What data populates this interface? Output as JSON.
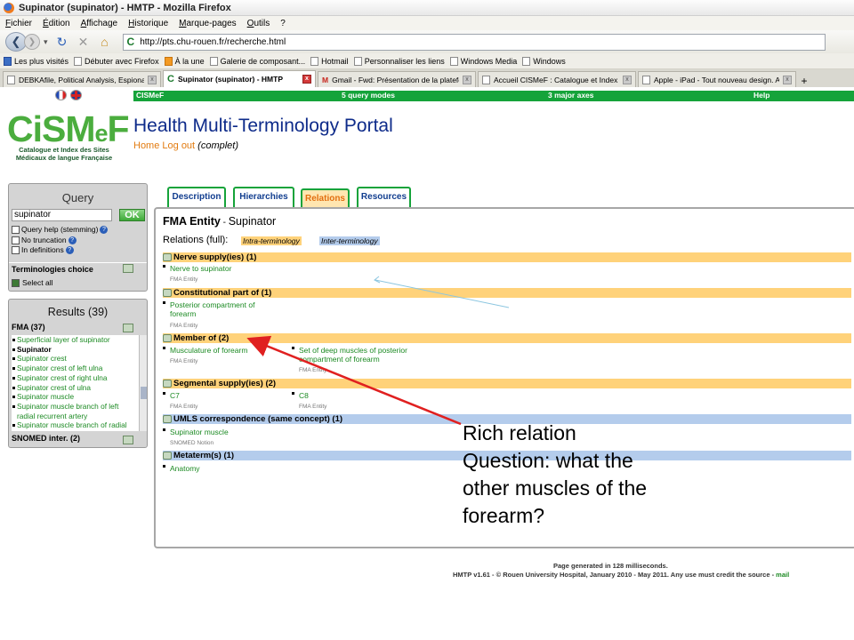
{
  "browser": {
    "window_title": "Supinator (supinator) - HMTP - Mozilla Firefox",
    "menu": [
      "Fichier",
      "Édition",
      "Affichage",
      "Historique",
      "Marque-pages",
      "Outils",
      "?"
    ],
    "url": "http://pts.chu-rouen.fr/recherche.html",
    "bookmarks": [
      "Les plus visités",
      "Débuter avec Firefox",
      "À la une",
      "Galerie de composant...",
      "Hotmail",
      "Personnaliser les liens",
      "Windows Media",
      "Windows"
    ],
    "tabs": [
      {
        "label": "DEBKAfile, Political Analysis, Espionage..."
      },
      {
        "label": "Supinator (supinator) - HMTP",
        "active": true
      },
      {
        "label": "Gmail - Fwd: Présentation de la platefo..."
      },
      {
        "label": "Accueil CISMeF : Catalogue et Index d..."
      },
      {
        "label": "Apple - iPad - Tout nouveau design. Ap..."
      }
    ]
  },
  "site": {
    "nav": [
      "CISMeF",
      "5 query modes",
      "3 major axes",
      "Help"
    ],
    "logo": {
      "text_a": "CiSM",
      "text_e": "e",
      "text_f": "F",
      "subtitle": "Catalogue et Index des Sites Médicaux de langue Française"
    },
    "title": "Health Multi-Terminology Portal",
    "home": "Home",
    "logout": "Log out",
    "logout_suffix": "(complet)"
  },
  "query": {
    "header": "Query",
    "value": "supinator",
    "ok": "OK",
    "options": [
      "Query help (stemming)",
      "No truncation",
      "In definitions"
    ],
    "terminologies_choice": "Terminologies choice",
    "select_all": "Select all"
  },
  "results": {
    "header": "Results (39)",
    "fma": "FMA (37)",
    "items": [
      "Superficial layer of supinator",
      "Supinator",
      "Supinator crest",
      "Supinator crest of left ulna",
      "Supinator crest of right ulna",
      "Supinator crest of ulna",
      "Supinator muscle",
      "Supinator muscle branch of left",
      "radial recurrent artery",
      "Supinator muscle branch of radial"
    ],
    "current_index": 1,
    "snomed": "SNOMED inter. (2)"
  },
  "content_tabs": [
    "Description",
    "Hierarchies",
    "Relations",
    "Resources"
  ],
  "entity": {
    "label": "FMA Entity",
    "sep": " - ",
    "name": "Supinator",
    "relations_label": "Relations (full):",
    "intra": "Intra-terminology",
    "inter": "Inter-terminology"
  },
  "sections": [
    {
      "title": "Nerve supply(ies) (1)",
      "items": [
        {
          "label": "Nerve to supinator",
          "note": "FMA Entity"
        }
      ]
    },
    {
      "title": "Constitutional part of (1)",
      "items": [
        {
          "label": "Posterior compartment of forearm",
          "note": "FMA Entity"
        }
      ]
    },
    {
      "title": "Member of (2)",
      "items": [
        {
          "label": "Musculature of forearm",
          "note": "FMA Entity"
        },
        {
          "label": "Set of deep muscles of posterior compartment of forearm",
          "note": "FMA Entity"
        }
      ]
    },
    {
      "title": "Segmental supply(ies) (2)",
      "items": [
        {
          "label": "C7",
          "note": "FMA Entity"
        },
        {
          "label": "C8",
          "note": "FMA Entity"
        }
      ]
    },
    {
      "title": "UMLS correspondence (same concept) (1)",
      "items": [
        {
          "label": "Supinator muscle",
          "note": "SNOMED Notion"
        }
      ]
    },
    {
      "title": "Metaterm(s) (1)",
      "items": [
        {
          "label": "Anatomy"
        }
      ]
    }
  ],
  "footer": {
    "line1": "Page generated in 128 milliseconds.",
    "line2": "HMTP v1.61 - © Rouen University Hospital, January 2010 - May 2011. Any use must credit the source - ",
    "mail": "mail"
  },
  "annotation": {
    "line1": "Rich relation",
    "line2": "Question: what the",
    "line3": "other muscles of the",
    "line4": "forearm?"
  },
  "colors": {
    "green": "#15a33a",
    "orange_band": "#ffd27a",
    "blue_band": "#b4ccec",
    "arrow": "#e02020"
  }
}
